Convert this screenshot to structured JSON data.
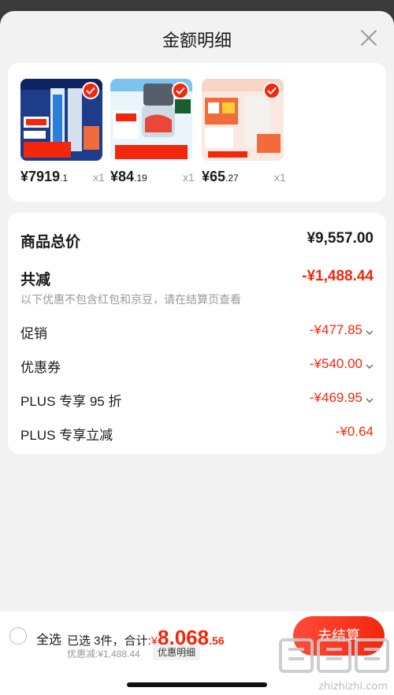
{
  "header": {
    "title": "金额明细"
  },
  "products": [
    {
      "price_int": "¥7919",
      "price_dec": ".1",
      "qty": "x1",
      "image": "air-conditioner",
      "colors": [
        "#1d3c8a",
        "#2a7fd8"
      ]
    },
    {
      "price_int": "¥84",
      "price_dec": ".19",
      "qty": "x1",
      "image": "meat-grinder",
      "colors": [
        "#7cc3f0",
        "#e8473a"
      ]
    },
    {
      "price_int": "¥65",
      "price_dec": ".27",
      "qty": "x1",
      "image": "electric-kettle",
      "colors": [
        "#fbe8e0",
        "#f26b3a"
      ]
    }
  ],
  "summary": {
    "total_label": "商品总价",
    "total_value": "¥9,557.00",
    "reduce_label": "共减",
    "reduce_value": "-¥1,488.44",
    "note": "以下优惠不包含红包和京豆，请在结算页查看",
    "items": [
      {
        "label": "促销",
        "value": "-¥477.85"
      },
      {
        "label": "优惠券",
        "value": "-¥540.00"
      },
      {
        "label": "PLUS 专享 95 折",
        "value": "-¥469.95"
      },
      {
        "label": "PLUS 专享立减",
        "value": "-¥0.64"
      }
    ]
  },
  "bottom": {
    "select_all": "全选",
    "selected_text": "已选 3件，合计:",
    "currency": "¥",
    "total_int": "8,068",
    "total_dec": ".56",
    "discount_text": "优惠减:¥1,488.44",
    "detail_link": "优惠明细",
    "checkout": "去结算"
  },
  "watermark": "zhizhizhi.com",
  "colors": {
    "accent": "#f2270c",
    "background": "#f2f2f2"
  }
}
